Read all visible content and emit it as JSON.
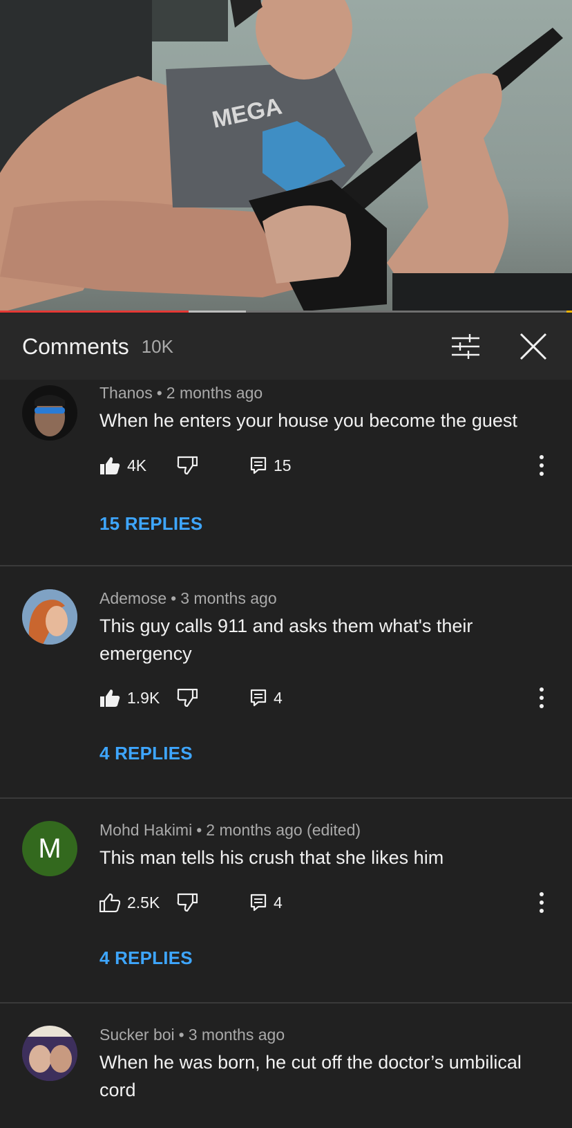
{
  "video": {
    "progress_fraction": 0.33,
    "buffered_fraction": 0.43
  },
  "header": {
    "title": "Comments",
    "count": "10K"
  },
  "comments": [
    {
      "author": "Thanos",
      "time": "2 months ago",
      "text": "When he enters your house you become the guest",
      "likes": "4K",
      "liked": true,
      "reply_count": "15",
      "replies_label": "15 REPLIES",
      "avatar_icon": "sunglasses-avatar"
    },
    {
      "author": "Ademose",
      "time": "3 months ago",
      "text": "This guy calls 911 and asks them what's their emergency",
      "likes": "1.9K",
      "liked": true,
      "reply_count": "4",
      "replies_label": "4 REPLIES",
      "avatar_icon": "redhead-avatar"
    },
    {
      "author": "Mohd Hakimi",
      "time": "2 months ago (edited)",
      "text": "This man tells his crush that she likes him",
      "likes": "2.5K",
      "liked": false,
      "reply_count": "4",
      "replies_label": "4 REPLIES",
      "avatar_letter": "M",
      "avatar_color": "#33691e"
    },
    {
      "author": "Sucker boi",
      "time": "3 months ago",
      "text": "When he was born, he cut off the doctor’s umbilical cord",
      "avatar_icon": "photo-avatar"
    }
  ],
  "colors": {
    "background": "#212121",
    "header": "#282828",
    "link": "#3ea6ff",
    "progress": "#e53935"
  }
}
